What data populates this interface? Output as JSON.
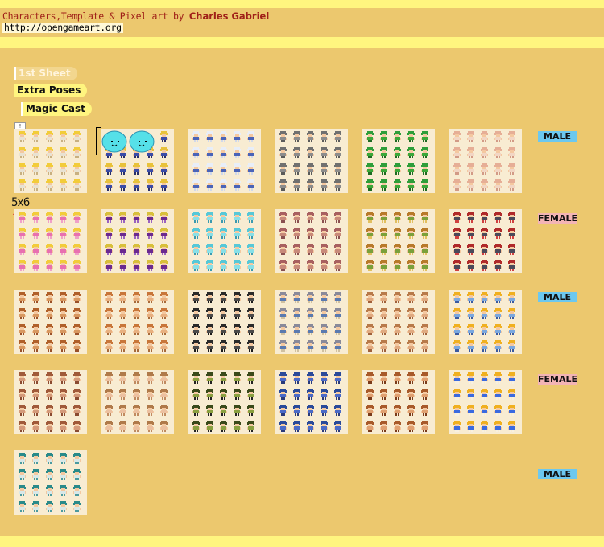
{
  "header": {
    "credit_text": "Characters,Template & Pixel art by",
    "author": "Charles Gabriel",
    "url": "http://opengameart.org"
  },
  "menu": {
    "first_sheet": "1st Sheet",
    "extra_poses": "Extra Poses",
    "magic_cast": "Magic Cast"
  },
  "note": "5x6",
  "row_tags": [
    "MALE",
    "FEMALE",
    "MALE",
    "FEMALE",
    "MALE"
  ],
  "colors": {
    "background": "#ecc86e",
    "stripe": "#fff57f",
    "male_tag": "#6cc8ef",
    "female_tag": "#f3b4b4",
    "credit_text": "#a02018"
  },
  "sheets": [
    [
      {
        "hair": "#f2cc3a",
        "body": "#e8e2d2",
        "legs": "#c8b080"
      },
      {
        "hair": "#e8c23a",
        "body": "#3a4ca8",
        "legs": "#2a2f6a",
        "slimes": true
      },
      {
        "hair": "#e8eef8",
        "body": "#4a64b8",
        "legs": "#d0d8ea"
      },
      {
        "hair": "#707070",
        "body": "#8c8c8c",
        "legs": "#5a5a5a"
      },
      {
        "hair": "#2e9e3a",
        "body": "#3aa83a",
        "legs": "#1e6a22"
      },
      {
        "hair": "#e6ae96",
        "body": "#f2d6c4",
        "legs": "#d29a86"
      }
    ],
    [
      {
        "hair": "#f2cc3a",
        "body": "#e870b0",
        "legs": "#f0a0c8"
      },
      {
        "hair": "#d8c03a",
        "body": "#6a2a90",
        "legs": "#9a62c0"
      },
      {
        "hair": "#56c8d8",
        "body": "#88e0e8",
        "legs": "#3a9ab0"
      },
      {
        "hair": "#a86060",
        "body": "#c88a7a",
        "legs": "#8a5050"
      },
      {
        "hair": "#b87a2a",
        "body": "#7aa03a",
        "legs": "#e2c060"
      },
      {
        "hair": "#b02a2a",
        "body": "#4a4a5a",
        "legs": "#d04040"
      }
    ],
    [
      {
        "hair": "#b0602a",
        "body": "#d89860",
        "legs": "#9a5028"
      },
      {
        "hair": "#c8763a",
        "body": "#e8b080",
        "legs": "#a86a3a"
      },
      {
        "hair": "#2a2a2a",
        "body": "#4a4a4a",
        "legs": "#1a1a1a"
      },
      {
        "hair": "#8a8a9a",
        "body": "#5a7ab0",
        "legs": "#d0c0a0"
      },
      {
        "hair": "#b87a4a",
        "body": "#e0aa80",
        "legs": "#a0603a"
      },
      {
        "hair": "#f0b020",
        "body": "#7aa8e0",
        "legs": "#3a5aa0"
      }
    ],
    [
      {
        "hair": "#a05a3a",
        "body": "#d49a7a",
        "legs": "#8a4a30"
      },
      {
        "hair": "#b07a4a",
        "body": "#ecc0a0",
        "legs": "#c08a60"
      },
      {
        "hair": "#3a4a1a",
        "body": "#8aa040",
        "legs": "#222"
      },
      {
        "hair": "#2a4a9a",
        "body": "#4a6ac8",
        "legs": "#2a3a7a"
      },
      {
        "hair": "#a85a2a",
        "body": "#e0a070",
        "legs": "#7a3a1a"
      },
      {
        "hair": "#f0b020",
        "body": "#3a6ae0",
        "legs": "#f8f0e0"
      }
    ],
    [
      {
        "hair": "#2a8a8a",
        "body": "#d8e8e8",
        "legs": "#4a9aa0"
      }
    ]
  ]
}
